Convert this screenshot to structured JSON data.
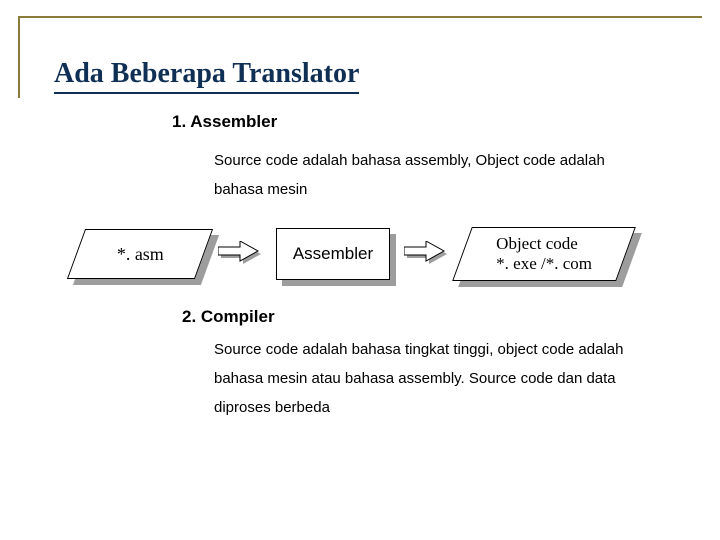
{
  "title": "Ada Beberapa Translator",
  "sec1": {
    "heading": "1. Assembler",
    "body": "Source code adalah bahasa assembly, Object code adalah bahasa mesin"
  },
  "diagram": {
    "asm": "*. asm",
    "mid": "Assembler",
    "out_line1": "Object code",
    "out_line2": "*. exe /*. com"
  },
  "sec2": {
    "heading": "2. Compiler",
    "body": "Source code adalah bahasa tingkat tinggi, object code adalah bahasa mesin atau bahasa assembly. Source code dan data diproses berbeda"
  }
}
